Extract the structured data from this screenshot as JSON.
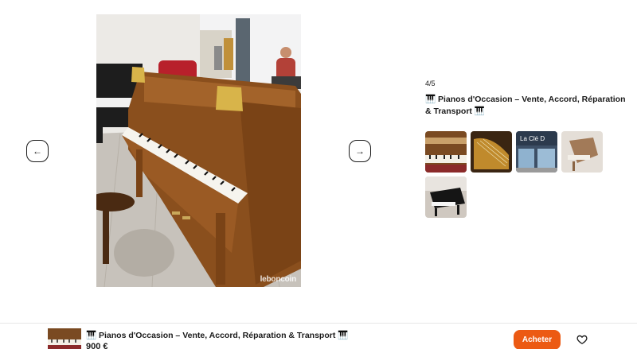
{
  "gallery": {
    "prev_icon": "←",
    "next_icon": "→",
    "watermark": "leboncoin",
    "counter": "4/5"
  },
  "listing": {
    "title": "🎹 Pianos d'Occasion – Vente, Accord, Réparation & Transport 🎹",
    "price": "900 €"
  },
  "thumbnails": [
    {
      "alt": "piano-keys-photo"
    },
    {
      "alt": "piano-interior-photo"
    },
    {
      "alt": "storefront-photo",
      "sign": "La Clé D"
    },
    {
      "alt": "grand-piano-light-photo"
    },
    {
      "alt": "grand-piano-dark-photo"
    }
  ],
  "actions": {
    "buy_label": "Acheter",
    "favorite_icon": "heart-icon"
  },
  "colors": {
    "accent": "#ec5a13",
    "text": "#1a1a1a"
  }
}
